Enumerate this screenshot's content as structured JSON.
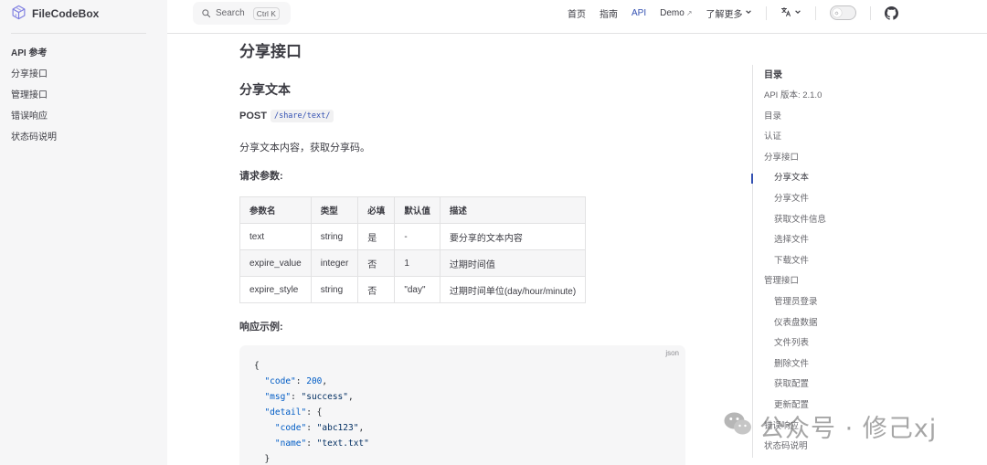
{
  "brand": {
    "name": "FileCodeBox",
    "icon": "cube-logo-icon"
  },
  "sidebar": {
    "items": [
      {
        "label": "API 参考",
        "type": "title"
      },
      {
        "label": "分享接口",
        "type": "link"
      },
      {
        "label": "管理接口",
        "type": "link"
      },
      {
        "label": "错误响应",
        "type": "link"
      },
      {
        "label": "状态码说明",
        "type": "link"
      }
    ]
  },
  "search": {
    "label": "Search",
    "shortcut": "Ctrl K",
    "icon": "search-icon"
  },
  "nav": {
    "home": "首页",
    "guide": "指南",
    "api": "API",
    "demo": "Demo",
    "demo_icon": "↗",
    "more": "了解更多",
    "more_icon": "chevron-down-icon",
    "translate_icon": "translate-icon",
    "theme_toggle": "theme-toggle",
    "github_icon": "github-icon",
    "active_color": "#3451b2"
  },
  "content": {
    "section_title": "分享接口",
    "sub_title": "分享文本",
    "method": "POST",
    "path": "/share/text/",
    "description": "分享文本内容，获取分享码。",
    "params_heading": "请求参数:",
    "table": {
      "headers": [
        "参数名",
        "类型",
        "必填",
        "默认值",
        "描述"
      ],
      "rows": [
        [
          "text",
          "string",
          "是",
          "-",
          "要分享的文本内容"
        ],
        [
          "expire_value",
          "integer",
          "否",
          "1",
          "过期时间值"
        ],
        [
          "expire_style",
          "string",
          "否",
          "\"day\"",
          "过期时间单位(day/hour/minute)"
        ]
      ]
    },
    "response_heading": "响应示例:",
    "code": {
      "lang": "json",
      "lines": [
        [
          [
            "p",
            "{"
          ]
        ],
        [
          [
            "p",
            "  "
          ],
          [
            "k",
            "\"code\""
          ],
          [
            "p",
            ": "
          ],
          [
            "n",
            "200"
          ],
          [
            "p",
            ","
          ]
        ],
        [
          [
            "p",
            "  "
          ],
          [
            "k",
            "\"msg\""
          ],
          [
            "p",
            ": "
          ],
          [
            "s",
            "\"success\""
          ],
          [
            "p",
            ","
          ]
        ],
        [
          [
            "p",
            "  "
          ],
          [
            "k",
            "\"detail\""
          ],
          [
            "p",
            ": {"
          ]
        ],
        [
          [
            "p",
            "    "
          ],
          [
            "k",
            "\"code\""
          ],
          [
            "p",
            ": "
          ],
          [
            "s",
            "\"abc123\""
          ],
          [
            "p",
            ","
          ]
        ],
        [
          [
            "p",
            "    "
          ],
          [
            "k",
            "\"name\""
          ],
          [
            "p",
            ": "
          ],
          [
            "s",
            "\"text.txt\""
          ]
        ],
        [
          [
            "p",
            "  }"
          ]
        ]
      ]
    }
  },
  "outline": {
    "title": "目录",
    "items": [
      {
        "label": "API 版本: 2.1.0",
        "level": 1
      },
      {
        "label": "目录",
        "level": 1
      },
      {
        "label": "认证",
        "level": 1
      },
      {
        "label": "分享接口",
        "level": 1
      },
      {
        "label": "分享文本",
        "level": 2,
        "active": true
      },
      {
        "label": "分享文件",
        "level": 2
      },
      {
        "label": "获取文件信息",
        "level": 2
      },
      {
        "label": "选择文件",
        "level": 2
      },
      {
        "label": "下载文件",
        "level": 2
      },
      {
        "label": "管理接口",
        "level": 1
      },
      {
        "label": "管理员登录",
        "level": 2
      },
      {
        "label": "仪表盘数据",
        "level": 2
      },
      {
        "label": "文件列表",
        "level": 2
      },
      {
        "label": "删除文件",
        "level": 2
      },
      {
        "label": "获取配置",
        "level": 2
      },
      {
        "label": "更新配置",
        "level": 2
      },
      {
        "label": "错误响应",
        "level": 1
      },
      {
        "label": "状态码说明",
        "level": 1
      }
    ]
  },
  "watermark": {
    "text": "公众号 · 修己xj",
    "icon": "wechat-icon"
  }
}
